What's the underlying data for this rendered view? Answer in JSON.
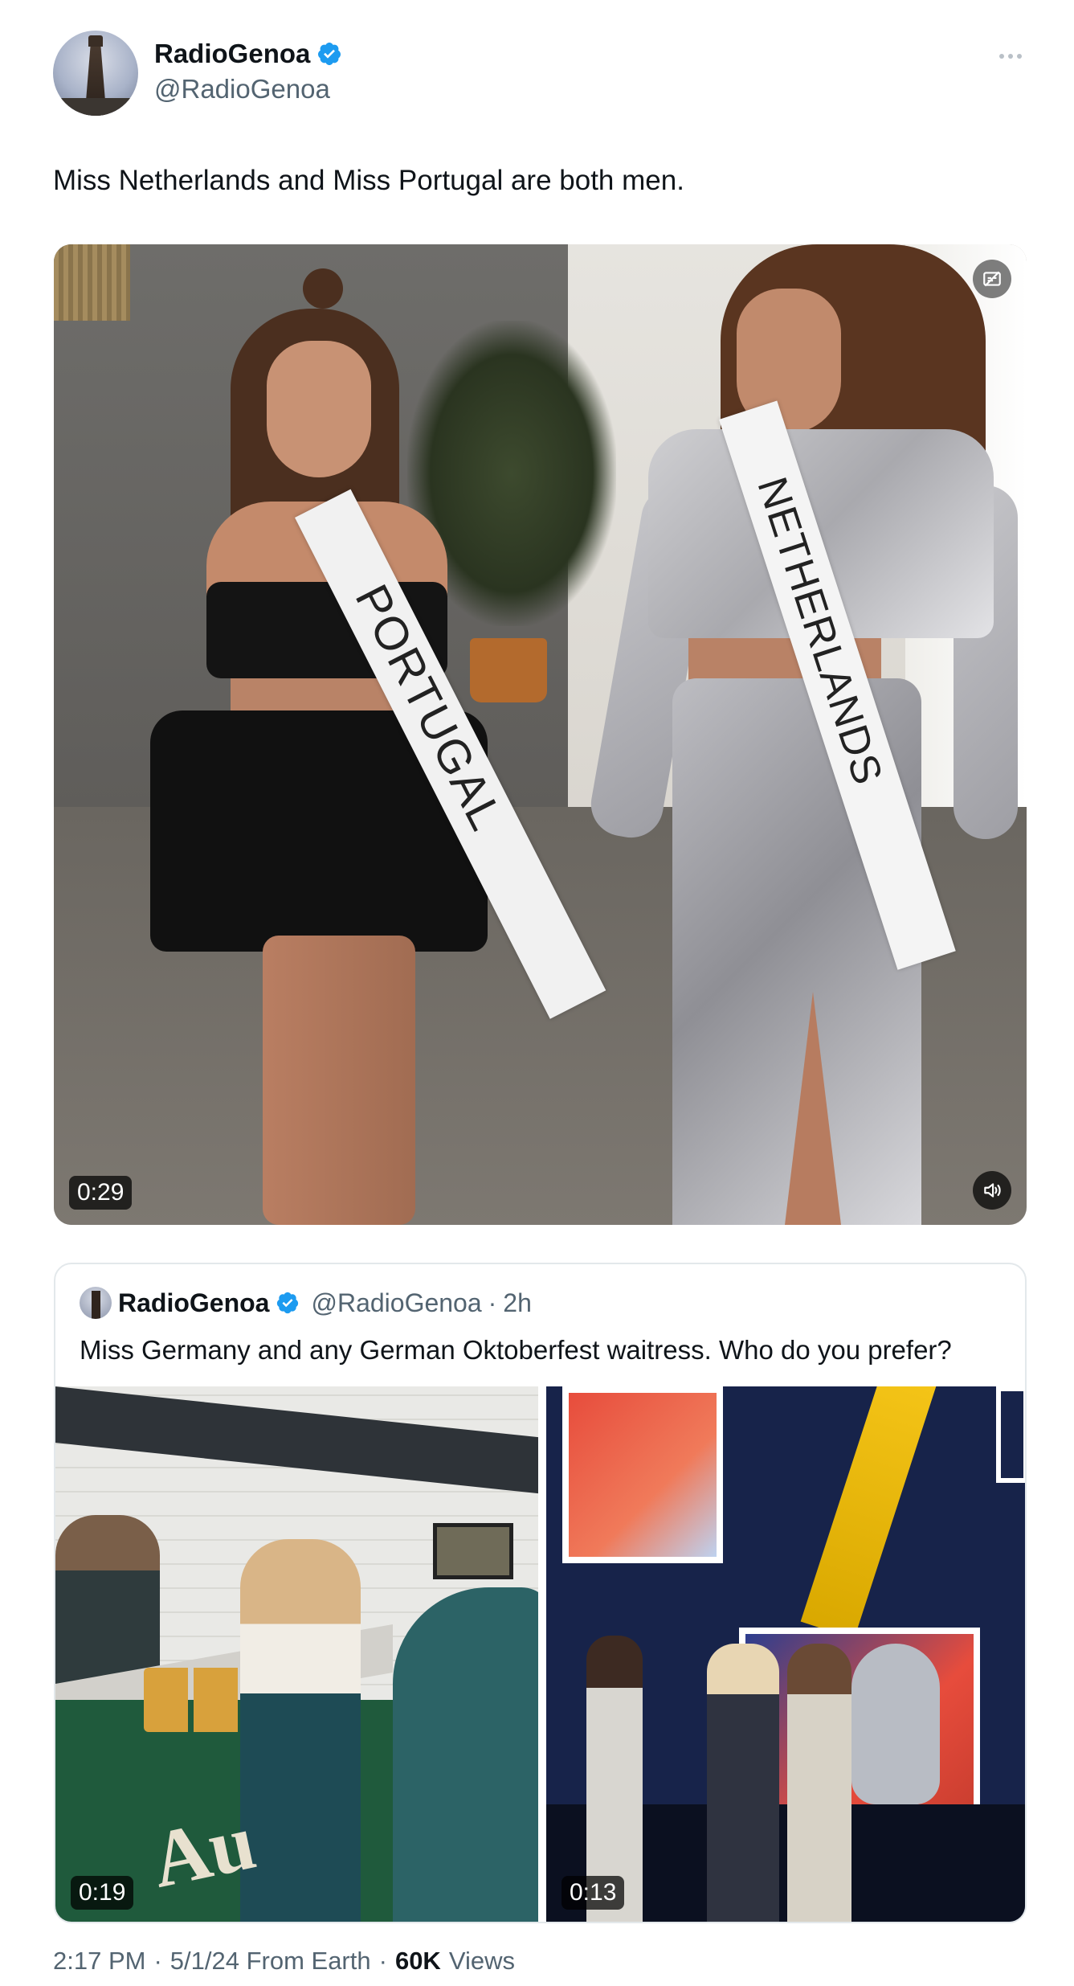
{
  "author": {
    "display_name": "RadioGenoa",
    "handle": "@RadioGenoa",
    "verified": true,
    "avatar_icon": "tower-avatar"
  },
  "tweet": {
    "text": "Miss Netherlands and Miss Portugal are both men."
  },
  "main_video": {
    "duration": "0:29",
    "sash_left_text": "PORTUGAL",
    "sash_right_text": "NETHERLANDS",
    "icons": [
      "captions-icon",
      "sound-icon"
    ]
  },
  "quoted_tweet": {
    "display_name": "RadioGenoa",
    "handle": "@RadioGenoa",
    "separator": "·",
    "time": "2h",
    "text": "Miss Germany and any German Oktoberfest waitress. Who do you prefer?",
    "media": [
      {
        "duration": "0:19",
        "logo_text": "Au"
      },
      {
        "duration": "0:13"
      }
    ]
  },
  "meta": {
    "time": "2:17 PM",
    "sep1": "·",
    "date_location": "5/1/24 From Earth",
    "sep2": "·",
    "views_count": "60K",
    "views_label": "Views"
  },
  "colors": {
    "verified": "#1d9bf0",
    "text_primary": "#0f1419",
    "text_secondary": "#536471",
    "border": "#e3e8eb"
  }
}
